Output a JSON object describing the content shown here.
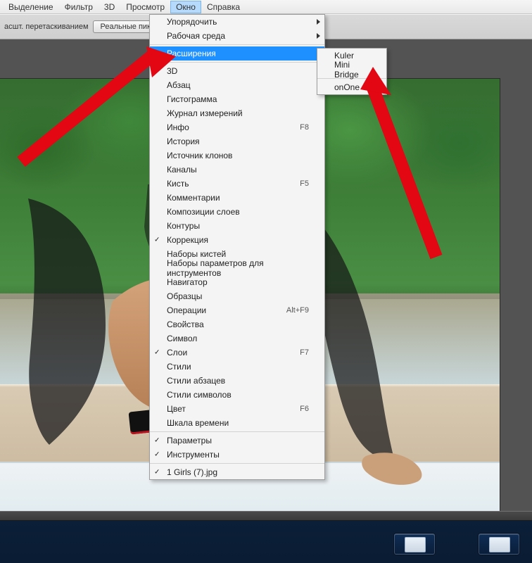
{
  "menubar": {
    "items": [
      "Выделение",
      "Фильтр",
      "3D",
      "Просмотр",
      "Окно",
      "Справка"
    ],
    "open_index": 4
  },
  "optionsbar": {
    "drag_text": "асшт. перетаскиванием",
    "real_px_btn": "Реальные пикселы"
  },
  "menu_window": {
    "items": [
      {
        "label": "Упорядочить",
        "sub": true
      },
      {
        "label": "Рабочая среда",
        "sub": true
      },
      {
        "sep": true
      },
      {
        "label": "Расширения",
        "sub": true,
        "highlight": true
      },
      {
        "sep": true
      },
      {
        "label": "3D"
      },
      {
        "label": "Абзац"
      },
      {
        "label": "Гистограмма"
      },
      {
        "label": "Журнал измерений"
      },
      {
        "label": "Инфо",
        "shortcut": "F8"
      },
      {
        "label": "История"
      },
      {
        "label": "Источник клонов"
      },
      {
        "label": "Каналы"
      },
      {
        "label": "Кисть",
        "shortcut": "F5"
      },
      {
        "label": "Комментарии"
      },
      {
        "label": "Композиции слоев"
      },
      {
        "label": "Контуры"
      },
      {
        "label": "Коррекция",
        "checked": true
      },
      {
        "label": "Наборы кистей"
      },
      {
        "label": "Наборы параметров для инструментов"
      },
      {
        "label": "Навигатор"
      },
      {
        "label": "Образцы"
      },
      {
        "label": "Операции",
        "shortcut": "Alt+F9"
      },
      {
        "label": "Свойства"
      },
      {
        "label": "Символ"
      },
      {
        "label": "Слои",
        "shortcut": "F7",
        "checked": true
      },
      {
        "label": "Стили"
      },
      {
        "label": "Стили абзацев"
      },
      {
        "label": "Стили символов"
      },
      {
        "label": "Цвет",
        "shortcut": "F6"
      },
      {
        "label": "Шкала времени"
      },
      {
        "sep": true
      },
      {
        "label": "Параметры",
        "checked": true
      },
      {
        "label": "Инструменты",
        "checked": true
      },
      {
        "sep": true
      },
      {
        "label": "1 Girls (7).jpg",
        "checked": true
      }
    ]
  },
  "submenu_ext": {
    "items": [
      {
        "label": "Kuler"
      },
      {
        "label": "Mini Bridge"
      },
      {
        "sep": true
      },
      {
        "label": "onOne"
      }
    ]
  }
}
